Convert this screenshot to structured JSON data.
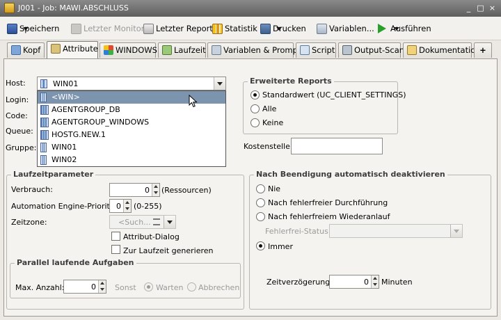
{
  "window": {
    "title": "J001 - Job: MAWI.ABSCHLUSS",
    "controls": [
      "_",
      "□",
      "×"
    ]
  },
  "toolbar": {
    "save": "Speichern",
    "monitor": "Letzter Monitor",
    "report": "Letzter Report",
    "stats": "Statistik",
    "print": "Drucken",
    "vars": "Variablen...",
    "run": "Ausführen"
  },
  "tabs": [
    "Kopf",
    "Attribute",
    "WINDOWS",
    "Laufzeit",
    "Variablen & Prompts",
    "Script",
    "Output-Scan",
    "Dokumentation",
    "+"
  ],
  "attributes": {
    "host_label": "Host:",
    "host_value": "WIN01",
    "login_label": "Login:",
    "code_label": "Code:",
    "queue_label": "Queue:",
    "group_label": "Gruppe:",
    "dropdown_items": [
      "<WIN>",
      "AGENTGROUP_DB",
      "AGENTGROUP_WINDOWS",
      "HOSTG.NEW.1",
      "WIN01",
      "WIN02"
    ]
  },
  "reports": {
    "legend": "Erweiterte Reports",
    "opt_default": "Standardwert (UC_CLIENT_SETTINGS)",
    "opt_all": "Alle",
    "opt_none": "Keine",
    "cost_label": "Kostenstelle:"
  },
  "runtime": {
    "legend": "Laufzeitparameter",
    "usage_label": "Verbrauch:",
    "usage_value": "0",
    "usage_unit": "(Ressourcen)",
    "prio_label": "Automation Engine-Priorität:",
    "prio_value": "0",
    "prio_range": "(0-255)",
    "tz_label": "Zeitzone:",
    "tz_placeholder": "<Such...",
    "attr_dialog": "Attribut-Dialog",
    "gen_at_runtime": "Zur Laufzeit generieren"
  },
  "parallel": {
    "legend": "Parallel laufende Aufgaben",
    "max_label": "Max. Anzahl:",
    "max_value": "0",
    "else_label": "Sonst",
    "wait": "Warten",
    "abort": "Abbrechen"
  },
  "deactivate": {
    "legend": "Nach Beendigung automatisch deaktivieren",
    "never": "Nie",
    "after_ok": "Nach fehlerfreier Durchführung",
    "after_restart": "Nach fehlerfreiem Wiederanlauf",
    "status_label": "Fehlerfrei-Status:",
    "always": "Immer",
    "delay_label": "Zeitverzögerung:",
    "delay_value": "0",
    "delay_unit": "Minuten"
  }
}
